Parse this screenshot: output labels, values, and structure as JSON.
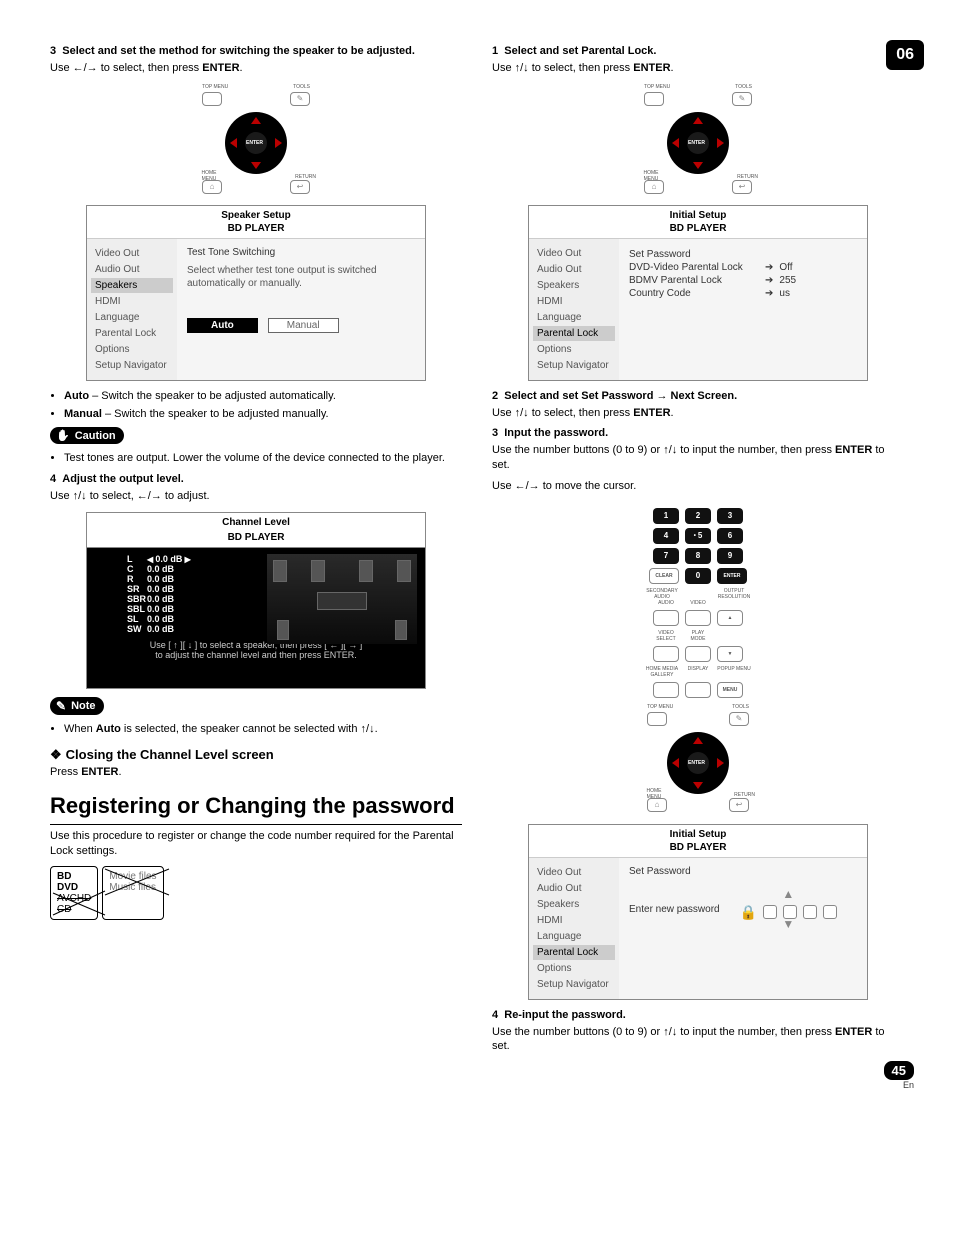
{
  "chapter": "06",
  "page_number": "45",
  "page_lang": "En",
  "left": {
    "step3_heading_num": "3",
    "step3_heading": "Select and set the method for switching the speaker to be adjusted.",
    "step3_instr_a": "Use ",
    "step3_instr_b": " to select, then press ",
    "step3_enter": "ENTER",
    "remote": {
      "top_menu": "TOP MENU",
      "tools": "TOOLS",
      "home_menu": "HOME\nMENU",
      "return": "RETURN",
      "enter": "ENTER"
    },
    "ui1": {
      "title": "Speaker Setup",
      "subtitle": "BD PLAYER",
      "sidebar": [
        "Video Out",
        "Audio Out",
        "Speakers",
        "HDMI",
        "Language",
        "Parental Lock",
        "Options",
        "Setup Navigator"
      ],
      "selected": "Speakers",
      "main_head": "Test Tone Switching",
      "main_desc": "Select whether test tone output is switched automatically or manually.",
      "btn_auto": "Auto",
      "btn_manual": "Manual"
    },
    "bullets1": [
      {
        "b": "Auto",
        "t": " – Switch the speaker to be adjusted automatically."
      },
      {
        "b": "Manual",
        "t": " – Switch the speaker to be adjusted manually."
      }
    ],
    "caution_label": "Caution",
    "caution_text": "Test tones are output. Lower the volume of the device connected to the player.",
    "step4_num": "4",
    "step4_heading": "Adjust the output level.",
    "step4_instr": "Use ↑/↓ to select, ←/→ to adjust.",
    "channel": {
      "title": "Channel Level",
      "subtitle": "BD PLAYER",
      "rows": [
        {
          "k": "L",
          "v": "0.0 dB",
          "sel": true
        },
        {
          "k": "C",
          "v": "0.0 dB"
        },
        {
          "k": "R",
          "v": "0.0 dB"
        },
        {
          "k": "SR",
          "v": "0.0 dB"
        },
        {
          "k": "SBR",
          "v": "0.0 dB"
        },
        {
          "k": "SBL",
          "v": "0.0 dB"
        },
        {
          "k": "SL",
          "v": "0.0 dB"
        },
        {
          "k": "SW",
          "v": "0.0 dB"
        }
      ],
      "hint1": "Use [ ↑ ][ ↓ ] to select a speaker, then press [ ← ][ → ]",
      "hint2": "to adjust the channel level and then press ENTER."
    },
    "note_label": "Note",
    "note_text_a": "When ",
    "note_text_b": "Auto",
    "note_text_c": " is selected, the speaker cannot be selected with ↑/↓.",
    "closing_heading": "Closing the Channel Level screen",
    "closing_text_a": "Press ",
    "closing_text_b": "ENTER",
    "section_title": "Registering or Changing the password",
    "section_body": "Use this procedure to register or change the code number required for the Parental Lock settings.",
    "media1": [
      "BD",
      "DVD",
      "AVCHD",
      "CD"
    ],
    "media2": [
      "Movie files",
      "Music files"
    ]
  },
  "right": {
    "step1_num": "1",
    "step1_heading": "Select and set Parental Lock.",
    "step1_instr": "Use ↑/↓ to select, then press ",
    "ui2": {
      "title": "Initial Setup",
      "subtitle": "BD PLAYER",
      "sidebar": [
        "Video Out",
        "Audio Out",
        "Speakers",
        "HDMI",
        "Language",
        "Parental Lock",
        "Options",
        "Setup Navigator"
      ],
      "selected": "Parental Lock",
      "items": [
        {
          "l": "Set Password",
          "v": ""
        },
        {
          "l": "DVD-Video Parental Lock",
          "v": "Off"
        },
        {
          "l": "BDMV Parental Lock",
          "v": "255"
        },
        {
          "l": "Country Code",
          "v": "us"
        }
      ]
    },
    "step2_num": "2",
    "step2_heading": "Select and set Set Password → Next Screen.",
    "step2_instr": "Use ↑/↓ to select, then press ",
    "step3_num": "3",
    "step3_heading": "Input the password.",
    "step3_body_a": "Use the number buttons (0 to 9) or ↑/↓ to input the number, then press ",
    "step3_body_b": " to set.",
    "step3_move": "Use ←/→ to move the cursor.",
    "keypad": {
      "r1": [
        "1",
        "2",
        "3"
      ],
      "r2": [
        "4",
        "5",
        "6"
      ],
      "r3": [
        "7",
        "8",
        "9"
      ],
      "r4": [
        "CLEAR",
        "0",
        "ENTER"
      ],
      "lbls1": [
        "SECONDARY AUDIO",
        "",
        "OUTPUT RESOLUTION"
      ],
      "lbls1b": [
        "AUDIO",
        "VIDEO",
        ""
      ],
      "lbls2": [
        "VIDEO SELECT",
        "PLAY MODE",
        ""
      ],
      "lbls3": [
        "HOME MEDIA GALLERY",
        "DISPLAY",
        "POPUP MENU"
      ],
      "top_menu": "TOP MENU",
      "tools": "TOOLS",
      "home_menu": "HOME\nMENU",
      "return": "RETURN",
      "enter": "ENTER"
    },
    "ui3": {
      "title": "Initial Setup",
      "subtitle": "BD PLAYER",
      "sidebar": [
        "Video Out",
        "Audio Out",
        "Speakers",
        "HDMI",
        "Language",
        "Parental Lock",
        "Options",
        "Setup Navigator"
      ],
      "selected": "Parental Lock",
      "main_head": "Set Password",
      "prompt": "Enter new password"
    },
    "step4_num": "4",
    "step4_heading": "Re-input the password.",
    "step4_body_a": "Use the number buttons (0 to 9) or ↑/↓ to input the number, then press ",
    "step4_body_b": " to set."
  }
}
